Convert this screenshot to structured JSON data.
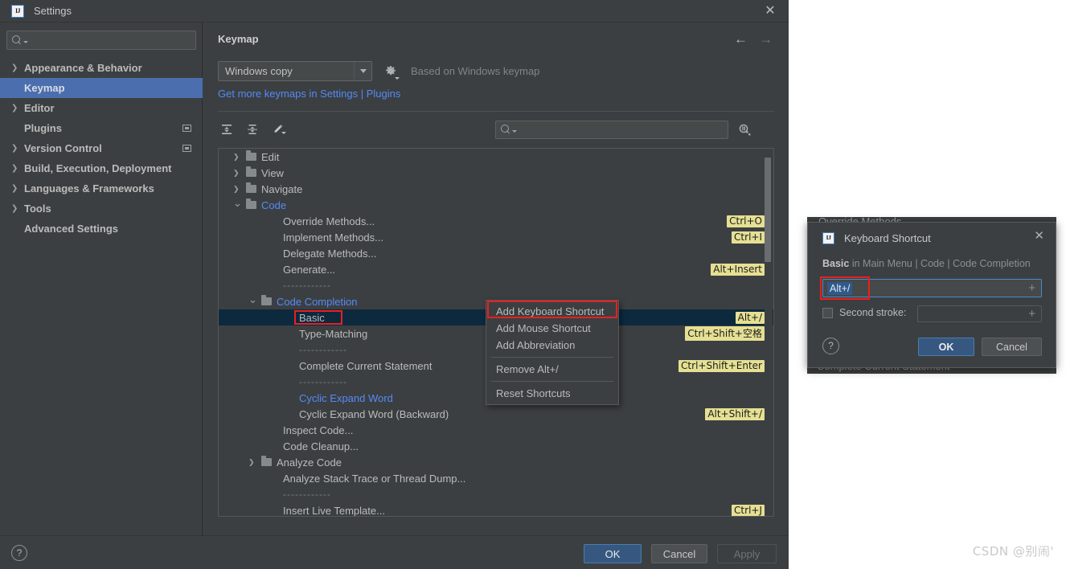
{
  "window": {
    "title": "Settings",
    "logo_text": "IJ",
    "close_icon": "✕"
  },
  "sidebar": {
    "search_placeholder": "",
    "items": [
      {
        "label": "Appearance & Behavior",
        "expandable": true,
        "selected": false,
        "badge": false
      },
      {
        "label": "Keymap",
        "expandable": false,
        "selected": true,
        "badge": false
      },
      {
        "label": "Editor",
        "expandable": true,
        "selected": false,
        "badge": false
      },
      {
        "label": "Plugins",
        "expandable": false,
        "selected": false,
        "badge": true
      },
      {
        "label": "Version Control",
        "expandable": true,
        "selected": false,
        "badge": true
      },
      {
        "label": "Build, Execution, Deployment",
        "expandable": true,
        "selected": false,
        "badge": false
      },
      {
        "label": "Languages & Frameworks",
        "expandable": true,
        "selected": false,
        "badge": false
      },
      {
        "label": "Tools",
        "expandable": true,
        "selected": false,
        "badge": false
      },
      {
        "label": "Advanced Settings",
        "expandable": false,
        "selected": false,
        "badge": false
      }
    ]
  },
  "panel": {
    "title": "Keymap",
    "back_arrow": "←",
    "forward_arrow": "→",
    "keymap_selected": "Windows copy",
    "based_on": "Based on Windows keymap",
    "plugins_link": "Get more keymaps in Settings | Plugins",
    "toolbar": {
      "expand_all": "expand-all-icon",
      "collapse_all": "collapse-all-icon",
      "edit": "edit-pencil-icon"
    },
    "tree_search_placeholder": "",
    "find_shortcut_icon": "find-by-shortcut-icon"
  },
  "tree": {
    "rows": [
      {
        "type": "folder",
        "label": "Edit",
        "indent": 28,
        "chev": "right",
        "blue": false,
        "shortcut": ""
      },
      {
        "type": "folder",
        "label": "View",
        "indent": 28,
        "chev": "right",
        "blue": false,
        "shortcut": ""
      },
      {
        "type": "folder",
        "label": "Navigate",
        "indent": 28,
        "chev": "right",
        "blue": false,
        "shortcut": ""
      },
      {
        "type": "folder",
        "label": "Code",
        "indent": 28,
        "chev": "down",
        "blue": true,
        "shortcut": ""
      },
      {
        "type": "leaf",
        "label": "Override Methods...",
        "indent": 80,
        "blue": false,
        "shortcut": "Ctrl+O"
      },
      {
        "type": "leaf",
        "label": "Implement Methods...",
        "indent": 80,
        "blue": false,
        "shortcut": "Ctrl+I"
      },
      {
        "type": "leaf",
        "label": "Delegate Methods...",
        "indent": 80,
        "blue": false,
        "shortcut": ""
      },
      {
        "type": "leaf",
        "label": "Generate...",
        "indent": 80,
        "blue": false,
        "shortcut": "Alt+Insert"
      },
      {
        "type": "sep",
        "label": "------------",
        "indent": 80,
        "blue": false,
        "shortcut": ""
      },
      {
        "type": "folder",
        "label": "Code Completion",
        "indent": 47,
        "chev": "down",
        "blue": true,
        "shortcut": ""
      },
      {
        "type": "leaf",
        "label": "Basic",
        "indent": 100,
        "blue": false,
        "shortcut": "Alt+/",
        "selected": true,
        "redbox": true
      },
      {
        "type": "leaf",
        "label": "Type-Matching",
        "indent": 100,
        "blue": false,
        "shortcut": "Ctrl+Shift+空格"
      },
      {
        "type": "sep",
        "label": "------------",
        "indent": 100,
        "blue": false,
        "shortcut": ""
      },
      {
        "type": "leaf",
        "label": "Complete Current Statement",
        "indent": 100,
        "blue": false,
        "shortcut": "Ctrl+Shift+Enter"
      },
      {
        "type": "sep",
        "label": "------------",
        "indent": 100,
        "blue": false,
        "shortcut": ""
      },
      {
        "type": "leaf",
        "label": "Cyclic Expand Word",
        "indent": 100,
        "blue": true,
        "shortcut": ""
      },
      {
        "type": "leaf",
        "label": "Cyclic Expand Word (Backward)",
        "indent": 100,
        "blue": false,
        "shortcut": "Alt+Shift+/"
      },
      {
        "type": "leaf",
        "label": "Inspect Code...",
        "indent": 80,
        "blue": false,
        "shortcut": ""
      },
      {
        "type": "leaf",
        "label": "Code Cleanup...",
        "indent": 80,
        "blue": false,
        "shortcut": ""
      },
      {
        "type": "folder",
        "label": "Analyze Code",
        "indent": 47,
        "chev": "right",
        "blue": false,
        "shortcut": ""
      },
      {
        "type": "leaf",
        "label": "Analyze Stack Trace or Thread Dump...",
        "indent": 80,
        "blue": false,
        "shortcut": ""
      },
      {
        "type": "sep",
        "label": "------------",
        "indent": 80,
        "blue": false,
        "shortcut": ""
      },
      {
        "type": "leaf",
        "label": "Insert Live Template...",
        "indent": 80,
        "blue": false,
        "shortcut": "Ctrl+J"
      }
    ]
  },
  "context_menu": {
    "items": [
      {
        "label": "Add Keyboard Shortcut",
        "highlighted": true
      },
      {
        "label": "Add Mouse Shortcut",
        "highlighted": false
      },
      {
        "label": "Add Abbreviation",
        "highlighted": false
      },
      {
        "separator": true
      },
      {
        "label": "Remove Alt+/",
        "highlighted": false
      },
      {
        "separator": true
      },
      {
        "label": "Reset Shortcuts",
        "highlighted": false
      }
    ]
  },
  "bottom_bar": {
    "help_label": "?",
    "ok_label": "OK",
    "cancel_label": "Cancel",
    "apply_label": "Apply"
  },
  "keyboard_shortcut_dialog": {
    "logo_text": "IJ",
    "title": "Keyboard Shortcut",
    "close_icon": "✕",
    "subtitle_strong": "Basic",
    "subtitle_dim": " in Main Menu | Code | Code Completion",
    "first_stroke_value": "Alt+/",
    "plus_icon": "+",
    "second_stroke_label": "Second stroke:",
    "second_stroke_value": "",
    "help_label": "?",
    "ok_label": "OK",
    "cancel_label": "Cancel"
  },
  "behind_dialog": {
    "top_text": "Override Methods...",
    "bottom_text": "Complete Current Statement"
  },
  "watermark": "CSDN @别闹'",
  "colors": {
    "window_bg": "#3c3f41",
    "sidebar_selection": "#4b6eaf",
    "tree_selection": "#0d293e",
    "link_blue": "#548af7",
    "shortcut_badge": "#e5e093",
    "accent_red": "#e82020",
    "primary_button": "#365880"
  }
}
